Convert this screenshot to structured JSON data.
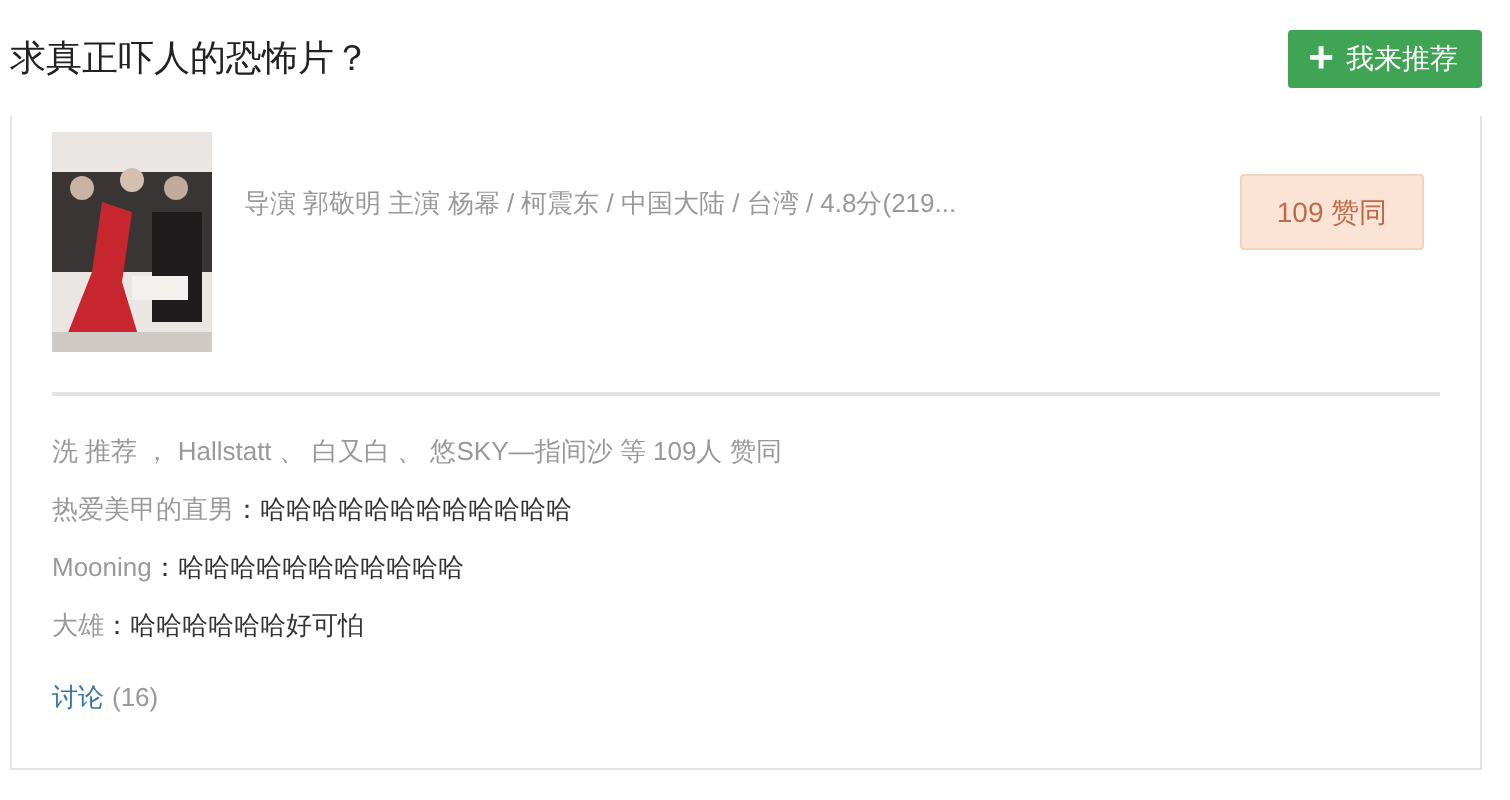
{
  "question": {
    "title": "求真正吓人的恐怖片？",
    "button": {
      "icon": "+",
      "label": "我来推荐"
    }
  },
  "recommendation": {
    "meta": "导演 郭敬明 主演 杨幂 / 柯震东 / 中国大陆 / 台湾 / 4.8分(219...",
    "votes": "109 赞同",
    "endorsers": "洗 推荐 ， Hallstatt 、 白又白 、 悠SKY—指间沙 等 109人 赞同",
    "comments": [
      {
        "name": "热爱美甲的直男",
        "text": "：哈哈哈哈哈哈哈哈哈哈哈哈"
      },
      {
        "name": "Mooning",
        "text": "：哈哈哈哈哈哈哈哈哈哈哈"
      },
      {
        "name": "大雄",
        "text": "：哈哈哈哈哈哈好可怕"
      }
    ],
    "discuss": {
      "label": "讨论",
      "count": "(16)"
    }
  }
}
